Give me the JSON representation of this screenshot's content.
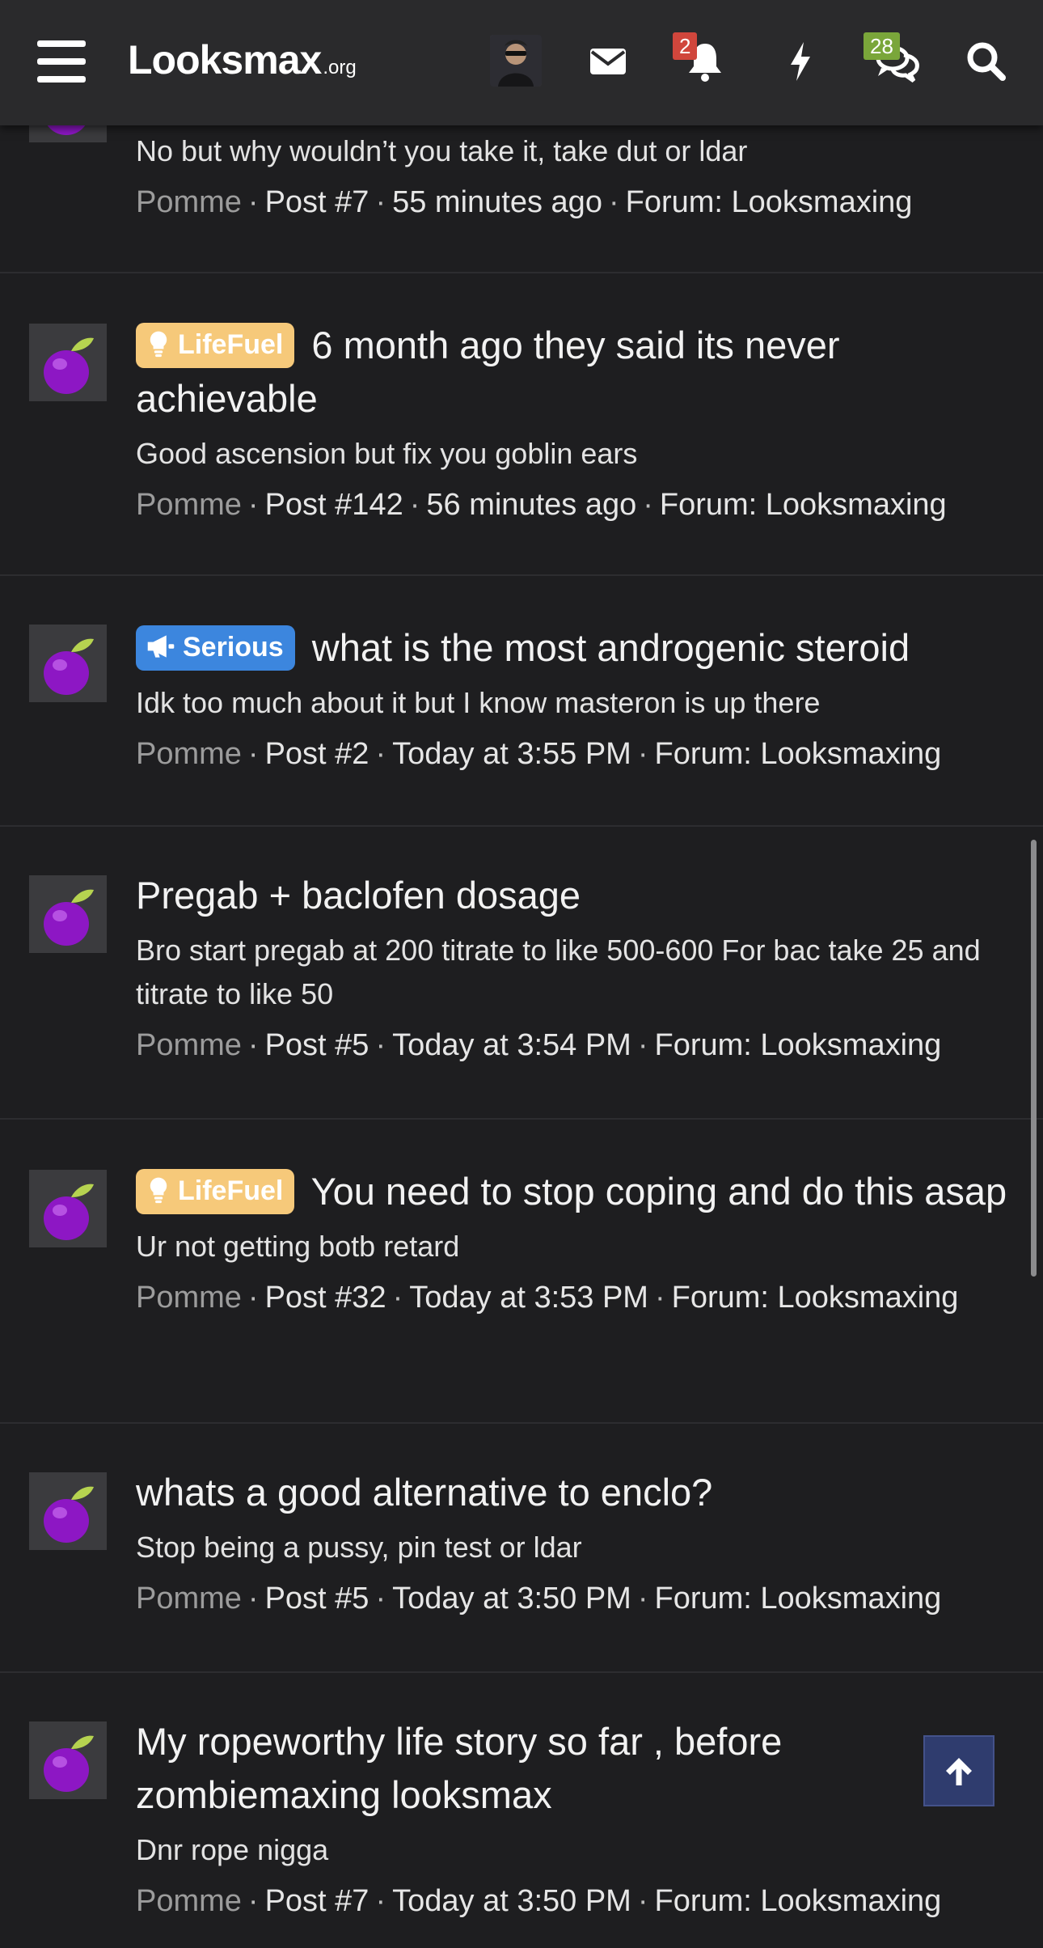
{
  "header": {
    "logo_main": "Looksmax",
    "logo_tld": ".org",
    "alerts_count": "2",
    "conversations_count": "28"
  },
  "colors": {
    "lifefuel_prefix": "#f6c97a",
    "serious_prefix": "#3c86de",
    "alert_badge": "#d0463c",
    "conversation_badge": "#7aa63a",
    "back_to_top": "#2f3c6e"
  },
  "posts": [
    {
      "prefix": "",
      "title": "",
      "snippet": "No but why wouldn’t you take it, take dut or ldar",
      "user": "Pomme",
      "post": "Post #7",
      "time": "55 minutes ago",
      "forum": "Forum: Looksmaxing"
    },
    {
      "prefix": "LifeFuel",
      "title": "6 month ago they said its never achievable",
      "snippet": "Good ascension but fix you goblin ears",
      "user": "Pomme",
      "post": "Post #142",
      "time": "56 minutes ago",
      "forum": "Forum: Looksmaxing"
    },
    {
      "prefix": "Serious",
      "title": "what is the most androgenic steroid",
      "snippet": "Idk too much about it but I know masteron is up there",
      "user": "Pomme",
      "post": "Post #2",
      "time": "Today at 3:55 PM",
      "forum": "Forum: Looksmaxing"
    },
    {
      "prefix": "",
      "title": "Pregab + baclofen dosage",
      "snippet": "Bro start pregab at 200 titrate to like 500-600 For bac take 25 and titrate to like 50",
      "user": "Pomme",
      "post": "Post #5",
      "time": "Today at 3:54 PM",
      "forum": "Forum: Looksmaxing"
    },
    {
      "prefix": "LifeFuel",
      "title": "You need to stop coping and do this asap",
      "snippet": "Ur not getting botb retard",
      "user": "Pomme",
      "post": "Post #32",
      "time": "Today at 3:53 PM",
      "forum": "Forum: Looksmaxing"
    },
    {
      "prefix": "",
      "title": "whats a good alternative to enclo?",
      "snippet": "Stop being a pussy, pin test or ldar",
      "user": "Pomme",
      "post": "Post #5",
      "time": "Today at 3:50 PM",
      "forum": "Forum: Looksmaxing"
    },
    {
      "prefix": "",
      "title": "My ropeworthy life story so far , before zombiemaxing looksmax",
      "snippet": "Dnr rope nigga",
      "user": "Pomme",
      "post": "Post #7",
      "time": "Today at 3:50 PM",
      "forum": "Forum: Looksmaxing"
    }
  ]
}
